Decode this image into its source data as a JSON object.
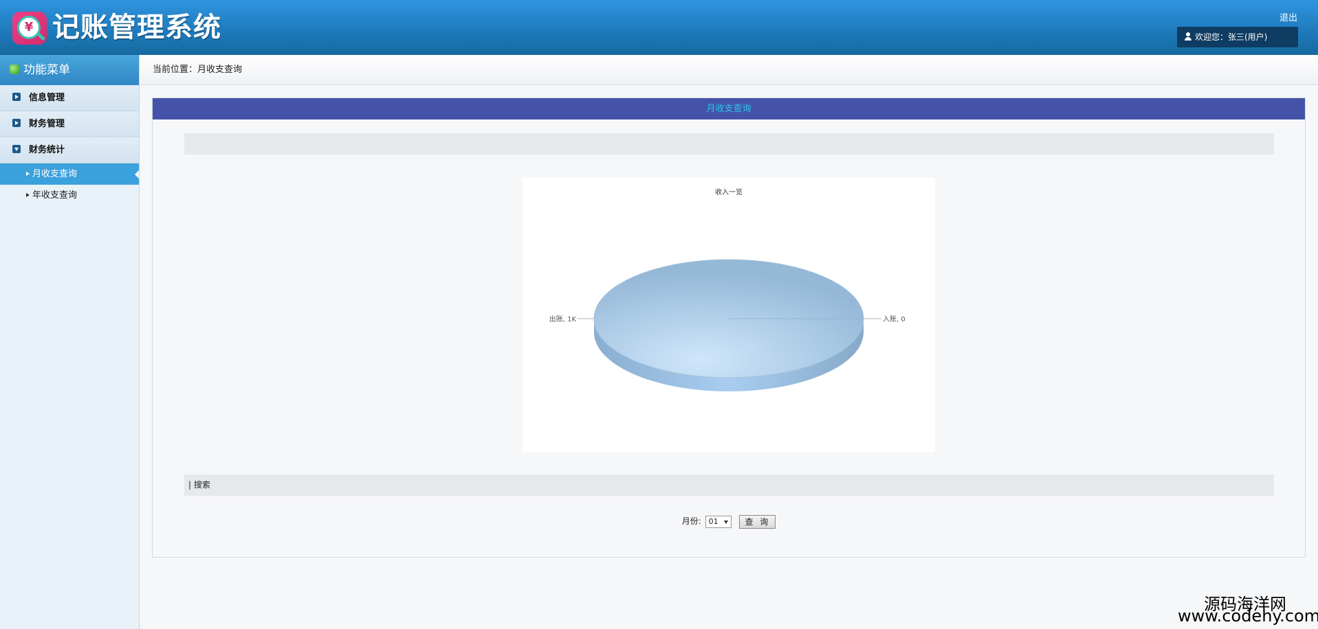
{
  "header": {
    "app_title": "记账管理系统",
    "logo_glyph": "¥",
    "logout_label": "退出",
    "welcome_text": "欢迎您：张三(用户)"
  },
  "sidebar": {
    "title": "功能菜单",
    "groups": [
      {
        "label": "信息管理",
        "expanded": false
      },
      {
        "label": "财务管理",
        "expanded": false
      },
      {
        "label": "财务统计",
        "expanded": true,
        "items": [
          {
            "label": "月收支查询",
            "active": true
          },
          {
            "label": "年收支查询",
            "active": false
          }
        ]
      }
    ]
  },
  "breadcrumb": {
    "text": "当前位置：月收支查询"
  },
  "panel": {
    "title": "月收支查询",
    "search_label": "| 搜索",
    "month_label": "月份:",
    "month_value": "01",
    "query_button": "查 询"
  },
  "chart_data": {
    "type": "pie",
    "title": "收入一览",
    "slices": [
      {
        "label": "出账",
        "value": 1000,
        "display": "出账, 1K"
      },
      {
        "label": "入账",
        "value": 0,
        "display": "入账, 0"
      }
    ],
    "style": "3d",
    "color": "#9ec0dc"
  },
  "watermark": {
    "line1": "源码海洋网",
    "line2": "www.codehy.com"
  }
}
